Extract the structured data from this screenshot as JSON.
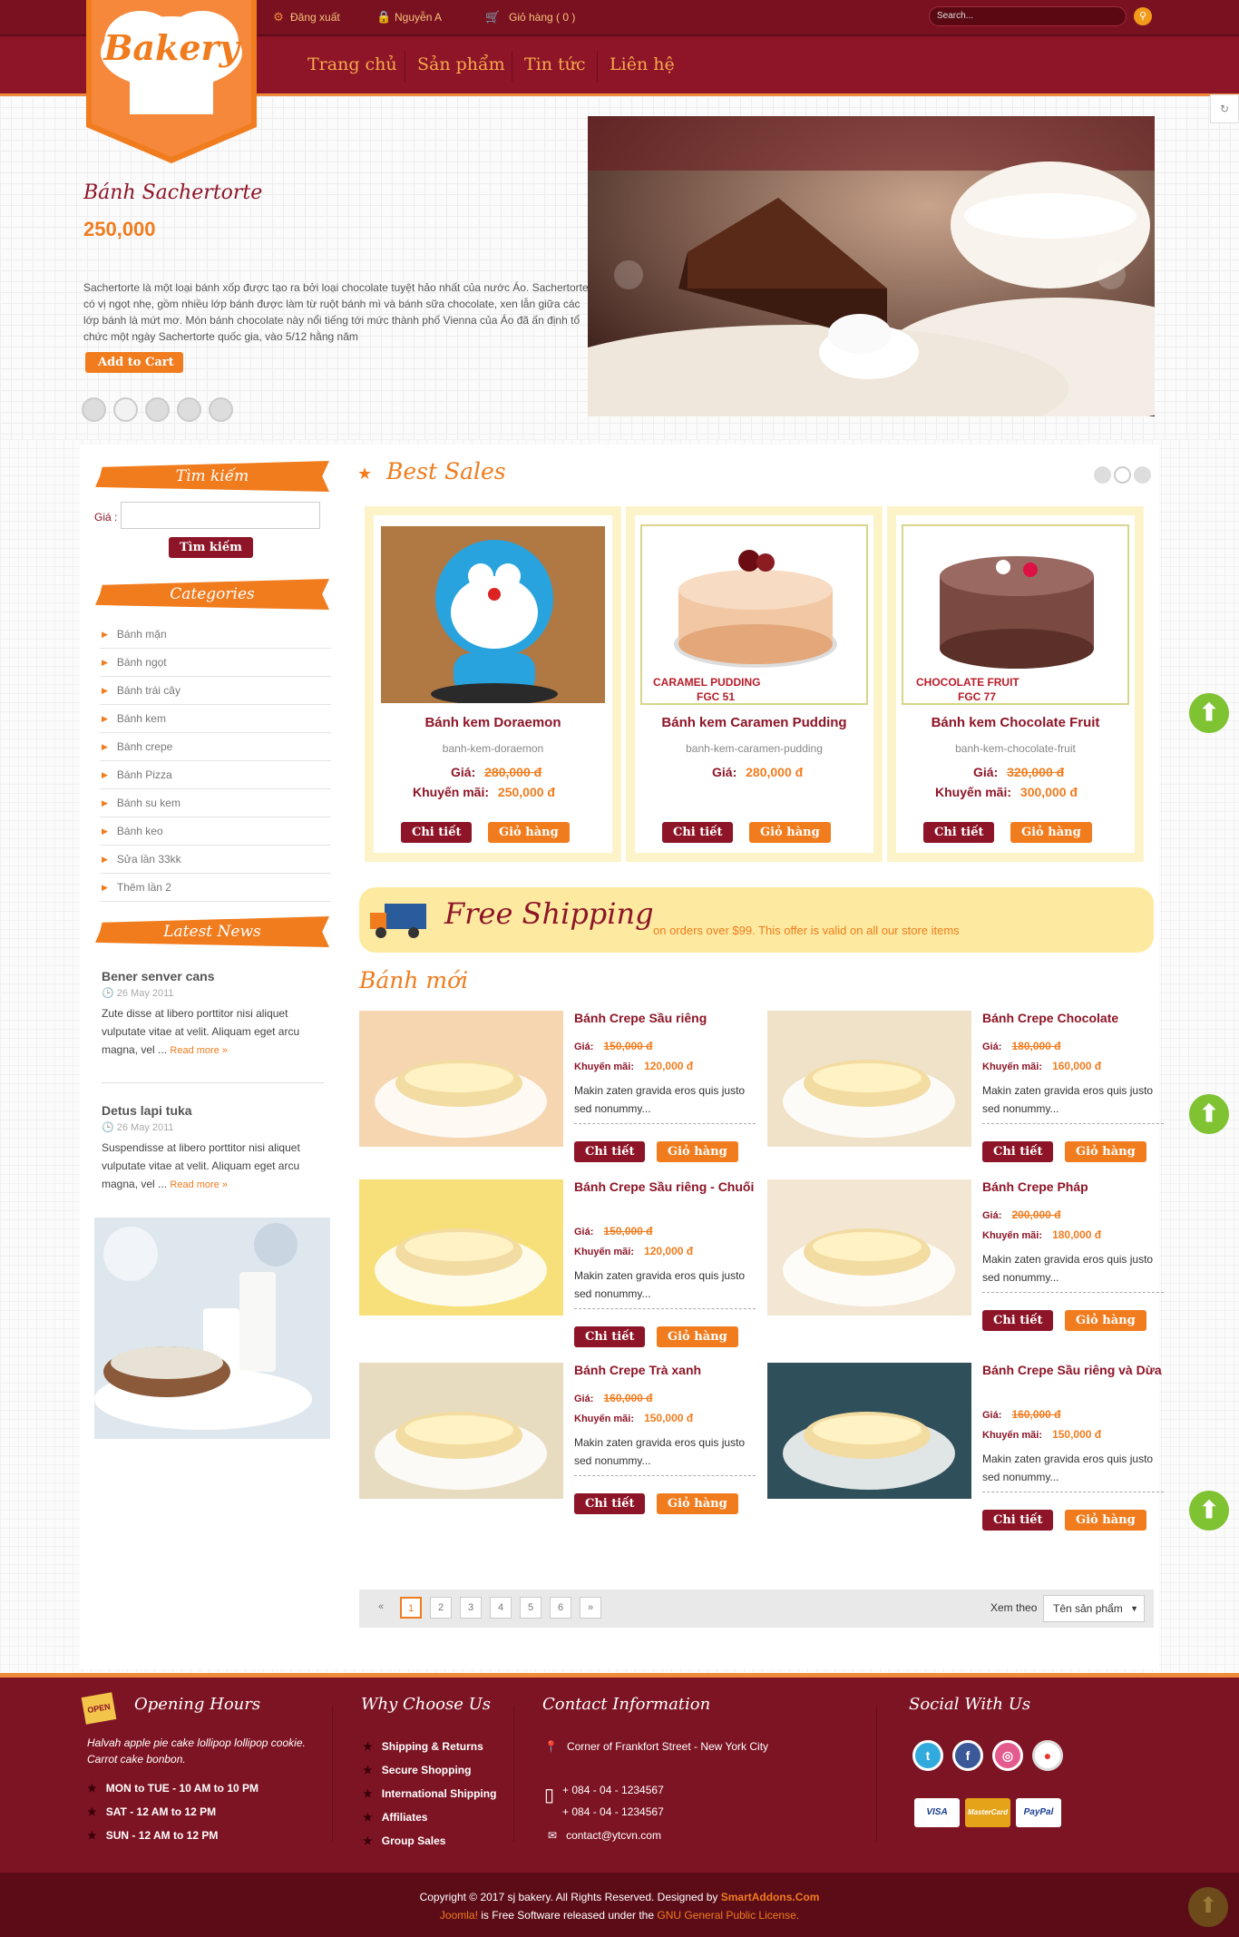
{
  "header": {
    "logout": "Đăng xuất",
    "user": "Nguyễn A",
    "cart": "Giỏ hàng ( 0 )",
    "search_placeholder": "Search...",
    "logo": "Bakery"
  },
  "nav": [
    "Trang chủ",
    "Sản phẩm",
    "Tin tức",
    "Liên hệ"
  ],
  "hero": {
    "title": "Bánh Sachertorte",
    "price": "250,000",
    "description": "Sachertorte là một loại bánh xốp được tạo ra bởi loại chocolate tuyệt hảo nhất của nước Áo. Sachertorte có vị ngọt nhẹ, gồm nhiều lớp bánh được làm từ ruột bánh mì và bánh sữa chocolate, xen lẫn giữa các lớp bánh là mứt mơ. Món bánh chocolate này nổi tiếng tới mức thành phố Vienna của Áo đã ấn định tổ chức một ngày Sachertorte quốc gia, vào 5/12 hằng năm",
    "add_to_cart": "Add to Cart",
    "slides": 5,
    "active_slide": 2
  },
  "sidebar": {
    "search_title": "Tìm kiếm",
    "price_label": "Giá :",
    "search_button": "Tìm kiếm",
    "categories_title": "Categories",
    "categories": [
      "Bánh mặn",
      "Bánh ngọt",
      "Bánh trái cây",
      "Bánh kem",
      "Bánh crepe",
      "Bánh Pizza",
      "Bánh su kem",
      "Bánh keo",
      "Sửa lần 33kk",
      "Thêm lần 2"
    ],
    "news_title": "Latest News",
    "news": [
      {
        "title": "Bener senver cans",
        "date": "26 May 2011",
        "text": "Zute disse at libero porttitor nisi aliquet vulputate vitae at velit. Aliquam eget arcu magna, vel ...",
        "more": "Read more »"
      },
      {
        "title": "Detus lapi tuka",
        "date": "26 May 2011",
        "text": "Suspendisse at libero porttitor nisi aliquet vulputate vitae at velit. Aliquam eget arcu magna, vel ...",
        "more": "Read more »"
      }
    ]
  },
  "best_sales": {
    "title": "Best Sales",
    "items": [
      {
        "name": "Bánh kem Doraemon",
        "slug": "banh-kem-doraemon",
        "price_label": "Giá:",
        "price": "280,000 đ",
        "promo_label": "Khuyến mãi:",
        "promo": "250,000 đ"
      },
      {
        "name": "Bánh kem Caramen Pudding",
        "slug": "banh-kem-caramen-pudding",
        "price_label": "Giá:",
        "price": "280,000 đ",
        "img_text": "CARAMEL PUDDING",
        "img_code": "FGC 51"
      },
      {
        "name": "Bánh kem Chocolate Fruit",
        "slug": "banh-kem-chocolate-fruit",
        "price_label": "Giá:",
        "price": "320,000 đ",
        "promo_label": "Khuyến mãi:",
        "promo": "300,000 đ",
        "img_text": "CHOCOLATE FRUIT",
        "img_code": "FGC 77"
      }
    ],
    "detail": "Chi tiết",
    "cart": "Giỏ hàng"
  },
  "shipping": {
    "title": "Free Shipping",
    "text": "on orders over $99. This offer is valid on all our store items"
  },
  "new_products": {
    "title": "Bánh mới",
    "price_label": "Giá:",
    "promo_label": "Khuyến mãi:",
    "desc": "Makin zaten gravida eros quis justo sed nonummy...",
    "detail": "Chi tiết",
    "cart": "Giỏ hàng",
    "items": [
      {
        "name": "Bánh Crepe Sầu riêng",
        "price": "150,000 đ",
        "promo": "120,000 đ"
      },
      {
        "name": "Bánh Crepe Chocolate",
        "price": "180,000 đ",
        "promo": "160,000 đ"
      },
      {
        "name": "Bánh Crepe Sầu riêng - Chuối",
        "price": "150,000 đ",
        "promo": "120,000 đ"
      },
      {
        "name": "Bánh Crepe Pháp",
        "price": "200,000 đ",
        "promo": "180,000 đ"
      },
      {
        "name": "Bánh Crepe Trà xanh",
        "price": "160,000 đ",
        "promo": "150,000 đ"
      },
      {
        "name": "Bánh Crepe Sầu riêng và Dừa",
        "price": "160,000 đ",
        "promo": "150,000 đ"
      }
    ]
  },
  "pager": {
    "pages": [
      "«",
      "1",
      "2",
      "3",
      "4",
      "5",
      "6",
      "»"
    ],
    "sort_label": "Xem theo",
    "sort_value": "Tên sản phẩm"
  },
  "footer": {
    "hours_title": "Opening Hours",
    "hours_intro": "Halvah apple pie cake lollipop lollipop cookie. Carrot cake bonbon.",
    "hours": [
      "MON to TUE - 10 AM to 10 PM",
      "SAT - 12 AM to 12 PM",
      "SUN - 12 AM to 12 PM"
    ],
    "open_sign": "OPEN",
    "why_title": "Why Choose Us",
    "why": [
      "Shipping & Returns",
      "Secure Shopping",
      "International Shipping",
      "Affiliates",
      "Group Sales"
    ],
    "contact_title": "Contact Information",
    "address": "Corner of Frankfort Street - New York City",
    "phone1": "+ 084 - 04 - 1234567",
    "phone2": "+ 084 - 04 - 1234567",
    "email": "contact@ytcvn.com",
    "social_title": "Social With Us",
    "payments": [
      "VISA",
      "MasterCard",
      "PayPal"
    ],
    "copyright1": "Copyright © 2017 sj bakery. All Rights Reserved. Designed by ",
    "designer": "SmartAddons.Com",
    "joomla": "Joomla!",
    "copyright2": " is Free Software released under the ",
    "license": "GNU General Public License."
  },
  "colors": {
    "maroon": "#8d1527",
    "orange": "#f07c1e",
    "cream": "#fdf3c8",
    "green": "#7fc232"
  }
}
